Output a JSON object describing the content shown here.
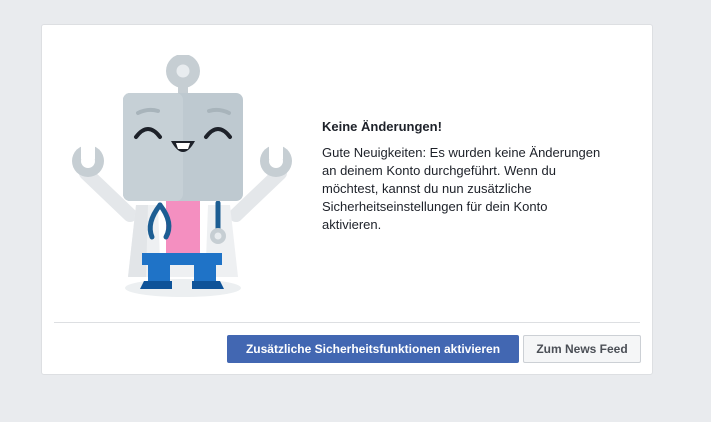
{
  "dialog": {
    "title": "Keine Änderungen!",
    "body": "Gute Neuigkeiten: Es wurden keine Änderungen\nan deinem Konto durchgeführt. Wenn du\nmöchtest, kannst du nun zusätzliche\nSicherheitseinstellungen für dein Konto\naktivieren.",
    "illustration": "doctor-robot-illustration"
  },
  "buttons": {
    "primary_label": "Zusätzliche Sicherheitsfunktionen aktivieren",
    "secondary_label": "Zum News Feed"
  },
  "colors": {
    "page_background": "#e9ebee",
    "primary_button": "#4267b2",
    "robot_face": "#bec9d0",
    "robot_shirt": "#f48fc0",
    "robot_pants": "#1f73c7",
    "stethoscope": "#1d5e93"
  }
}
